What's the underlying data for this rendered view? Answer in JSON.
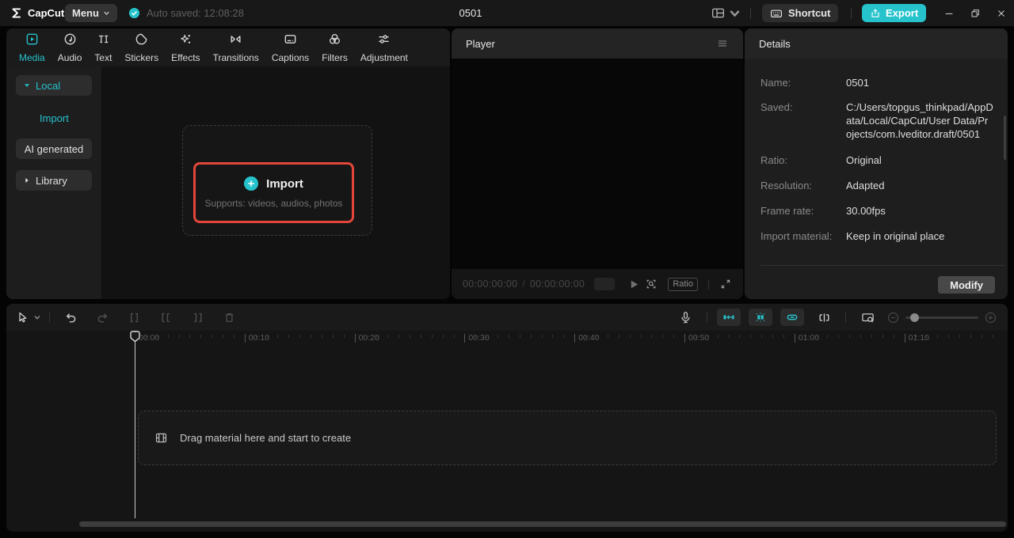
{
  "topbar": {
    "logo_text": "CapCut",
    "menu_label": "Menu",
    "autosave_text": "Auto saved: 12:08:28",
    "project_title": "0501",
    "shortcut_label": "Shortcut",
    "export_label": "Export"
  },
  "media_panel": {
    "tabs": [
      {
        "label": "Media",
        "icon": "media",
        "active": true
      },
      {
        "label": "Audio",
        "icon": "audio",
        "active": false
      },
      {
        "label": "Text",
        "icon": "text",
        "active": false
      },
      {
        "label": "Stickers",
        "icon": "stickers",
        "active": false
      },
      {
        "label": "Effects",
        "icon": "effects",
        "active": false
      },
      {
        "label": "Transitions",
        "icon": "transitions",
        "active": false
      },
      {
        "label": "Captions",
        "icon": "captions",
        "active": false
      },
      {
        "label": "Filters",
        "icon": "filters",
        "active": false
      },
      {
        "label": "Adjustment",
        "icon": "adjustment",
        "active": false
      }
    ],
    "sidebar_items": [
      {
        "label": "Local",
        "type": "group",
        "caret": "down",
        "active": true
      },
      {
        "label": "Import",
        "type": "link",
        "caret": "",
        "active": true
      },
      {
        "label": "AI generated",
        "type": "chip",
        "caret": "",
        "active": false
      },
      {
        "label": "Library",
        "type": "group-closed",
        "caret": "right",
        "active": false
      }
    ],
    "import_box": {
      "title": "Import",
      "subtitle": "Supports: videos, audios, photos"
    }
  },
  "player": {
    "title": "Player",
    "current_time": "00:00:00:00",
    "time_separator": "/",
    "total_time": "00:00:00:00",
    "ratio_label": "Ratio"
  },
  "details": {
    "title": "Details",
    "rows": [
      {
        "label": "Name:",
        "value": "0501"
      },
      {
        "label": "Saved:",
        "value": "C:/Users/topgus_thinkpad/AppData/Local/CapCut/User Data/Projects/com.lveditor.draft/0501"
      },
      {
        "label": "Ratio:",
        "value": "Original"
      },
      {
        "label": "Resolution:",
        "value": "Adapted"
      },
      {
        "label": "Frame rate:",
        "value": "30.00fps"
      },
      {
        "label": "Import material:",
        "value": "Keep in original place"
      }
    ],
    "modify_label": "Modify"
  },
  "timeline": {
    "ruler_labels": [
      "00:00",
      "00:10",
      "00:20",
      "00:30",
      "00:40",
      "00:50",
      "01:00",
      "01:10"
    ],
    "drag_hint": "Drag material here and start to create"
  },
  "colors": {
    "accent": "#26c3cd",
    "highlight_border": "#e2463a"
  }
}
